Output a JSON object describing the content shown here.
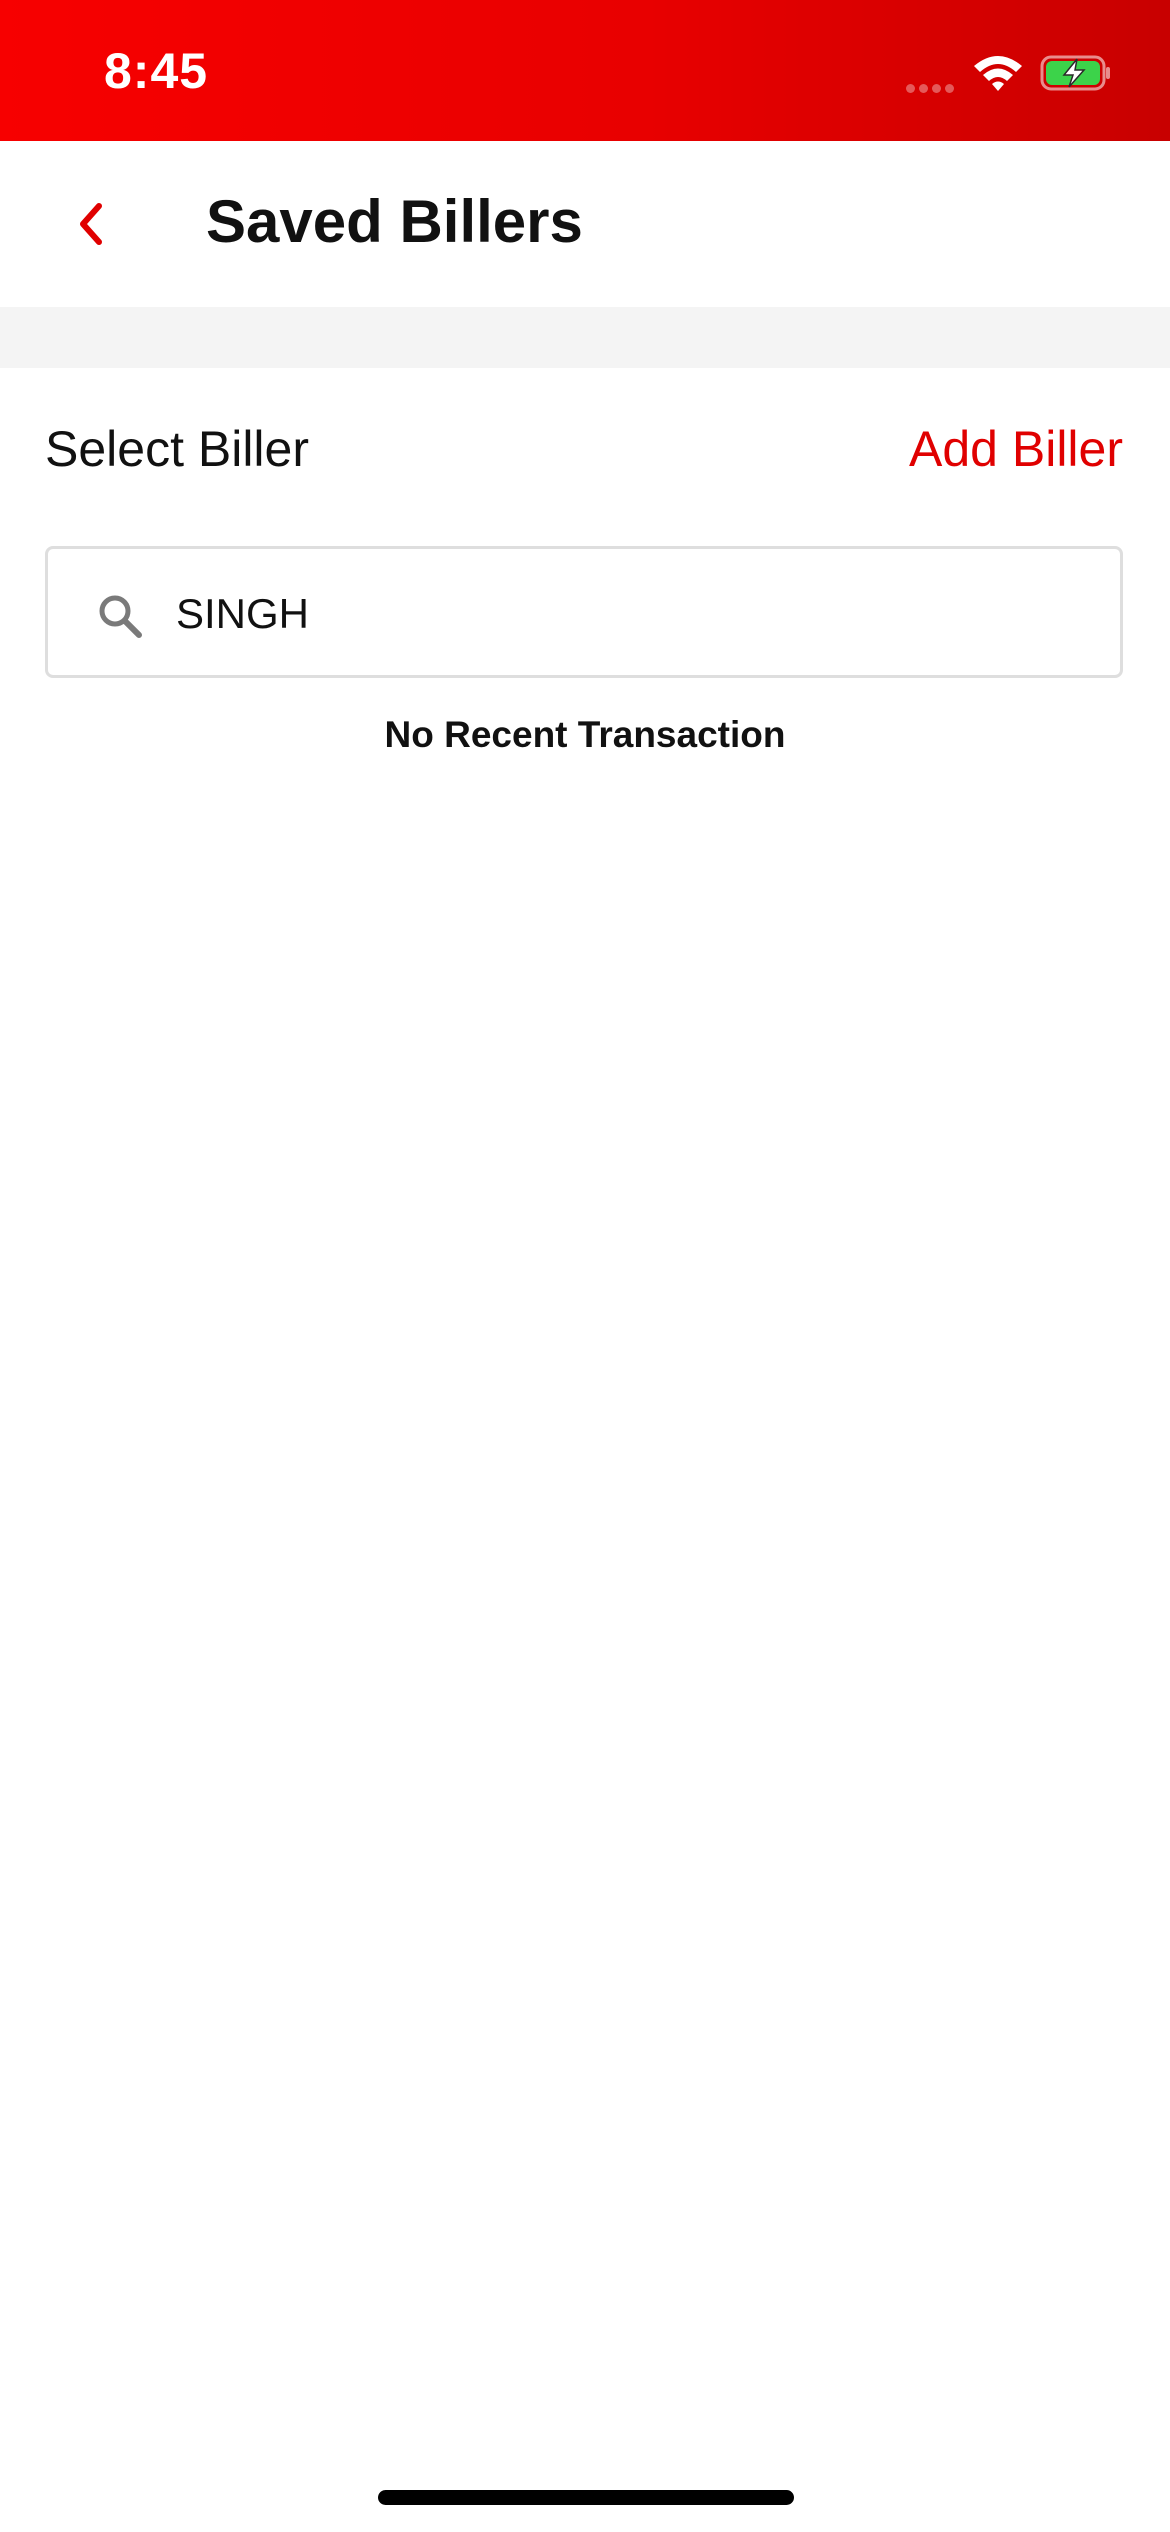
{
  "status_bar": {
    "time": "8:45",
    "background": "#e80000"
  },
  "header": {
    "title": "Saved Billers",
    "back_icon": "chevron-left-icon",
    "accent_color": "#e00000"
  },
  "section": {
    "label": "Select Biller",
    "action_label": "Add Biller"
  },
  "search": {
    "icon": "search-icon",
    "value": "SINGH",
    "placeholder": ""
  },
  "empty_state": {
    "message": "No Recent Transaction"
  }
}
